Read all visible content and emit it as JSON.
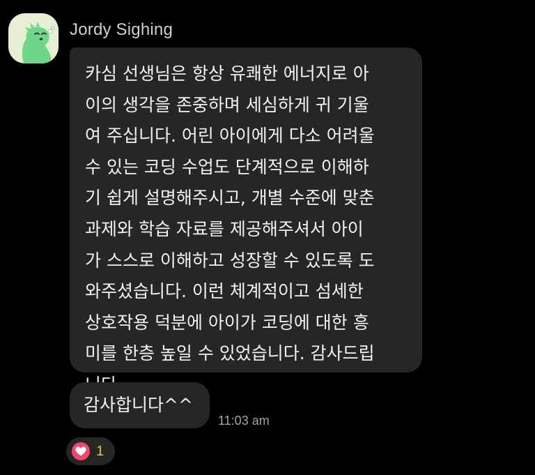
{
  "sender": {
    "name": "Jordy Sighing",
    "avatar_icon": "green-dinosaur-avatar-icon"
  },
  "messages": [
    {
      "lines": [
        "카심 선생님은 항상 유쾌한 에너지로 아",
        "이의 생각을 존중하며 세심하게 귀 기울",
        "여 주십니다. 어린 아이에게 다소 어려울",
        "수 있는 코딩 수업도 단계적으로 이해하",
        "기 쉽게 설명해주시고, 개별 수준에 맞춘",
        "과제와 학습 자료를 제공해주셔서 아이",
        "가 스스로 이해하고 성장할 수 있도록 도",
        "와주셨습니다. 이런 체계적이고 섬세한",
        "상호작용 덕분에 아이가 코딩에 대한 흥",
        "미를 한층 높일 수 있었습니다. 감사드립",
        "니다."
      ]
    },
    {
      "text": "감사합니다^^",
      "time": "11:03 am"
    }
  ],
  "reaction": {
    "icon": "heart-icon",
    "count": "1",
    "color": "#f0476f"
  },
  "colors": {
    "background": "#000000",
    "bubble": "#262626",
    "name_text": "#cfcfcf",
    "time_text": "#a5a5a5",
    "avatar_bg": "#e6efd3",
    "dino_green": "#6fd687"
  }
}
